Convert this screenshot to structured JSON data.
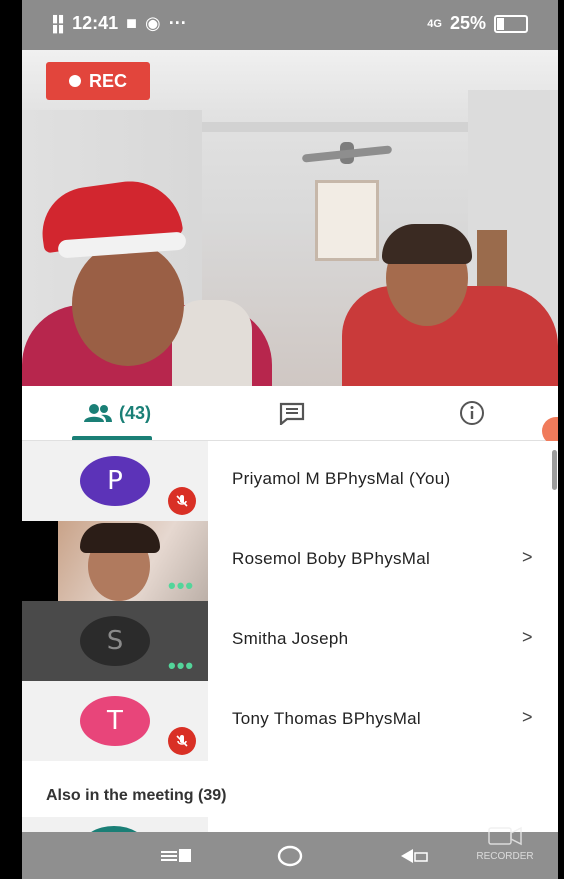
{
  "status_bar": {
    "time": "12:41",
    "signal_label": "4G",
    "battery": "25%"
  },
  "video": {
    "rec_label": "REC"
  },
  "tabs": {
    "people_count": "(43)",
    "people_icon": "people-icon",
    "chat_icon": "chat-icon",
    "info_icon": "info-icon",
    "active_color": "#1a7f76"
  },
  "participants": [
    {
      "initial": "P",
      "name": "Priyamol M BPhysMal (You)",
      "avatar_color": "#5c33b8",
      "muted": true
    },
    {
      "initial": "",
      "name": "Rosemol Boby BPhysMal",
      "has_video": true
    },
    {
      "initial": "S",
      "name": "Smitha Joseph",
      "avatar_color": "#2b2b2b"
    },
    {
      "initial": "T",
      "name": "Tony Thomas BPhysMal",
      "avatar_color": "#e8457a",
      "muted": true
    }
  ],
  "section": {
    "also_in_meeting": "Also in the meeting (39)"
  },
  "watermark": "RECORDER"
}
